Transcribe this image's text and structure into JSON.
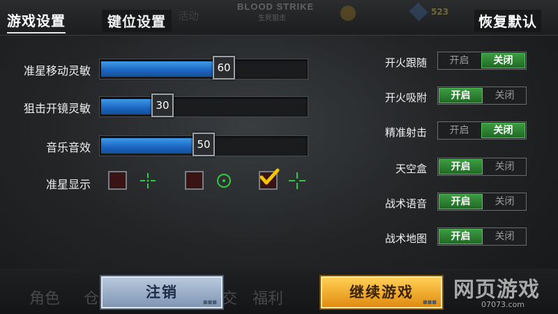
{
  "header": {
    "tab_active": "游戏设置",
    "tab_inactive": "键位设置",
    "reset_label": "恢复默认",
    "bg_event": "活动",
    "brand": "BLOOD STRIKE",
    "brand_sub": "生死狙击",
    "gem_count": "523"
  },
  "sliders": [
    {
      "label": "准星移动灵敏",
      "value": 60
    },
    {
      "label": "狙击开镜灵敏",
      "value": 30
    },
    {
      "label": "音乐音效",
      "value": 50
    }
  ],
  "crosshair": {
    "label": "准星显示",
    "options": [
      {
        "icon": "cross-gap-crosshair-icon",
        "checked": false
      },
      {
        "icon": "circle-dot-crosshair-icon",
        "checked": false
      },
      {
        "icon": "cross-crosshair-icon",
        "checked": true
      }
    ]
  },
  "toggles": {
    "on_label": "开启",
    "off_label": "关闭",
    "items": [
      {
        "label": "开火跟随",
        "enabled": false
      },
      {
        "label": "开火吸附",
        "enabled": true
      },
      {
        "label": "精准射击",
        "enabled": false
      },
      {
        "label": "天空盒",
        "enabled": true
      },
      {
        "label": "战术语音",
        "enabled": true
      },
      {
        "label": "战术地图",
        "enabled": true
      }
    ]
  },
  "buttons": {
    "cancel": "注销",
    "continue": "继续游戏"
  },
  "bottom_nav_bg": [
    "角色",
    "仓",
    "交",
    "福利"
  ],
  "watermark": {
    "main": "网页游戏",
    "sub": "07073.com"
  },
  "colors": {
    "slider_fill": "#1a64c0",
    "toggle_on": "#2f8a34",
    "cancel_button": "#9fb2cc",
    "continue_button": "#f0a828",
    "crosshair": "#2ecc40",
    "check": "#f5c400"
  }
}
